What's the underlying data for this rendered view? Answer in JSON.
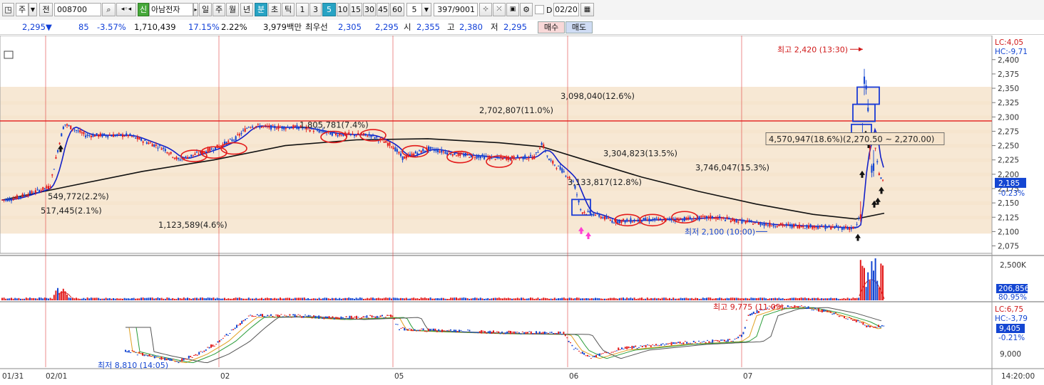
{
  "toolbar": {
    "type_code": "주",
    "prev_label": "전",
    "stock_code": "008700",
    "badge_new": "신",
    "stock_name": "아남전자",
    "period_tabs": [
      "일",
      "주",
      "월",
      "년",
      "분",
      "초",
      "틱"
    ],
    "active_period": "분",
    "interval_tabs": [
      "1",
      "3",
      "5",
      "10",
      "15",
      "30",
      "45",
      "60"
    ],
    "active_interval": "5",
    "interval_value": "5",
    "count_value": "397/9001",
    "d_label": "D",
    "date_value": "02/20"
  },
  "quote": {
    "price": "2,295",
    "change": "85",
    "change_pct": "-3.57%",
    "volume": "1,710,439",
    "turnover_pct": "17.15%",
    "ratio": "2.22%",
    "amount": "3,979백만",
    "best_label": "최우선",
    "ask": "2,305",
    "bid": "2,295",
    "open_label": "시",
    "open": "2,355",
    "high_label": "고",
    "high": "2,380",
    "low_label": "저",
    "low": "2,295",
    "buy_label": "매수",
    "sell_label": "매도"
  },
  "chart_data": {
    "type": "candlestick",
    "symbol": "008700",
    "name": "아남전자",
    "interval": "5분",
    "price_axis": {
      "ticks": [
        "2,400",
        "2,375",
        "2,350",
        "2,325",
        "2,300",
        "2,275",
        "2,250",
        "2,225",
        "2,200",
        "2,175",
        "2,150",
        "2,125",
        "2,100",
        "2,075"
      ],
      "ylim": [
        2062,
        2432
      ]
    },
    "lc_label": "LC:4,05",
    "hc_label": "HC:-9,71",
    "high_annotation": "최고 2,420 (13:30)",
    "low_annotation": "최저 2,100 (10:00)",
    "current_price_label": "2,185",
    "current_change_label": "-0.23%",
    "reference_line": 2293,
    "volume_profile": [
      {
        "label": "2,702,807(11.0%)",
        "price": 2312
      },
      {
        "label": "3,098,040(12.6%)",
        "price": 2337
      },
      {
        "label": "1,805,781(7.4%)",
        "price": 2287
      },
      {
        "label": "4,570,947(18.6%)(2,270.50 ~ 2,270.00)",
        "price": 2262
      },
      {
        "label": "3,304,823(13.5%)",
        "price": 2237
      },
      {
        "label": "3,746,047(15.3%)",
        "price": 2212
      },
      {
        "label": "3,133,817(12.8%)",
        "price": 2187
      },
      {
        "label": "549,772(2.2%)",
        "price": 2162
      },
      {
        "label": "517,445(2.1%)",
        "price": 2137
      },
      {
        "label": "1,123,589(4.6%)",
        "price": 2112
      }
    ],
    "volume_axis": {
      "label": "2,500K",
      "current": "206,856",
      "pct": "80.95%"
    },
    "lower_panel": {
      "lc_label": "LC:6,75",
      "hc_label": "HC:-3,79",
      "current": "9,405",
      "pct": "-0.21%",
      "tick": "9,000",
      "high_annotation": "최고 9,775 (11:05)",
      "low_annotation": "최저 8,810 (14:05)"
    },
    "x_labels": [
      "01/31",
      "02/01",
      "02",
      "05",
      "06",
      "07"
    ],
    "time_label": "14:20:00",
    "colors": {
      "up": "#e31b1b",
      "down": "#1446d2",
      "ma_short": "#1220c8",
      "ma_long": "#111111",
      "band": "#f6e4cc",
      "highlight_circle": "#e31b1b",
      "highlight_box": "#1a3bd6",
      "signal_pink": "#ff3cd2"
    }
  }
}
